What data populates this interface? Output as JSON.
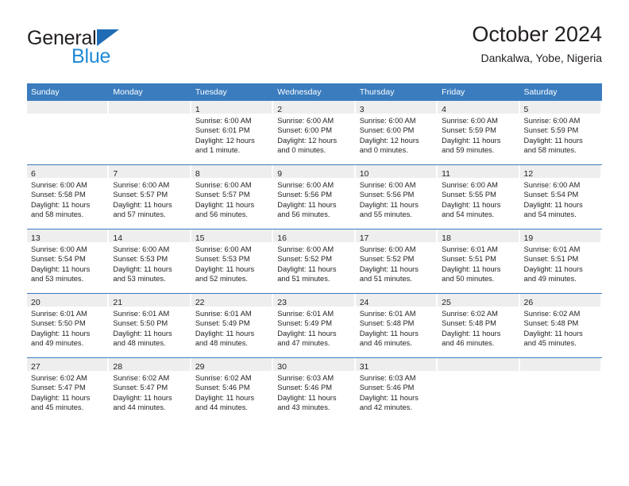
{
  "brand": {
    "logo_primary": "General",
    "logo_secondary": "Blue",
    "triangle_color": "#1f6cb4",
    "secondary_color": "#1f8ad6"
  },
  "header": {
    "title": "October 2024",
    "subtitle": "Dankalwa, Yobe, Nigeria"
  },
  "theme": {
    "header_bg": "#3a7cbe",
    "day_strip_bg": "#eeeeee",
    "text_color": "#231f20",
    "grid_line": "#3a7cbe"
  },
  "weekday_headers": [
    "Sunday",
    "Monday",
    "Tuesday",
    "Wednesday",
    "Thursday",
    "Friday",
    "Saturday"
  ],
  "weeks": [
    [
      {
        "day": "",
        "lines": []
      },
      {
        "day": "",
        "lines": []
      },
      {
        "day": "1",
        "lines": [
          "Sunrise: 6:00 AM",
          "Sunset: 6:01 PM",
          "Daylight: 12 hours",
          "and 1 minute."
        ]
      },
      {
        "day": "2",
        "lines": [
          "Sunrise: 6:00 AM",
          "Sunset: 6:00 PM",
          "Daylight: 12 hours",
          "and 0 minutes."
        ]
      },
      {
        "day": "3",
        "lines": [
          "Sunrise: 6:00 AM",
          "Sunset: 6:00 PM",
          "Daylight: 12 hours",
          "and 0 minutes."
        ]
      },
      {
        "day": "4",
        "lines": [
          "Sunrise: 6:00 AM",
          "Sunset: 5:59 PM",
          "Daylight: 11 hours",
          "and 59 minutes."
        ]
      },
      {
        "day": "5",
        "lines": [
          "Sunrise: 6:00 AM",
          "Sunset: 5:59 PM",
          "Daylight: 11 hours",
          "and 58 minutes."
        ]
      }
    ],
    [
      {
        "day": "6",
        "lines": [
          "Sunrise: 6:00 AM",
          "Sunset: 5:58 PM",
          "Daylight: 11 hours",
          "and 58 minutes."
        ]
      },
      {
        "day": "7",
        "lines": [
          "Sunrise: 6:00 AM",
          "Sunset: 5:57 PM",
          "Daylight: 11 hours",
          "and 57 minutes."
        ]
      },
      {
        "day": "8",
        "lines": [
          "Sunrise: 6:00 AM",
          "Sunset: 5:57 PM",
          "Daylight: 11 hours",
          "and 56 minutes."
        ]
      },
      {
        "day": "9",
        "lines": [
          "Sunrise: 6:00 AM",
          "Sunset: 5:56 PM",
          "Daylight: 11 hours",
          "and 56 minutes."
        ]
      },
      {
        "day": "10",
        "lines": [
          "Sunrise: 6:00 AM",
          "Sunset: 5:56 PM",
          "Daylight: 11 hours",
          "and 55 minutes."
        ]
      },
      {
        "day": "11",
        "lines": [
          "Sunrise: 6:00 AM",
          "Sunset: 5:55 PM",
          "Daylight: 11 hours",
          "and 54 minutes."
        ]
      },
      {
        "day": "12",
        "lines": [
          "Sunrise: 6:00 AM",
          "Sunset: 5:54 PM",
          "Daylight: 11 hours",
          "and 54 minutes."
        ]
      }
    ],
    [
      {
        "day": "13",
        "lines": [
          "Sunrise: 6:00 AM",
          "Sunset: 5:54 PM",
          "Daylight: 11 hours",
          "and 53 minutes."
        ]
      },
      {
        "day": "14",
        "lines": [
          "Sunrise: 6:00 AM",
          "Sunset: 5:53 PM",
          "Daylight: 11 hours",
          "and 53 minutes."
        ]
      },
      {
        "day": "15",
        "lines": [
          "Sunrise: 6:00 AM",
          "Sunset: 5:53 PM",
          "Daylight: 11 hours",
          "and 52 minutes."
        ]
      },
      {
        "day": "16",
        "lines": [
          "Sunrise: 6:00 AM",
          "Sunset: 5:52 PM",
          "Daylight: 11 hours",
          "and 51 minutes."
        ]
      },
      {
        "day": "17",
        "lines": [
          "Sunrise: 6:00 AM",
          "Sunset: 5:52 PM",
          "Daylight: 11 hours",
          "and 51 minutes."
        ]
      },
      {
        "day": "18",
        "lines": [
          "Sunrise: 6:01 AM",
          "Sunset: 5:51 PM",
          "Daylight: 11 hours",
          "and 50 minutes."
        ]
      },
      {
        "day": "19",
        "lines": [
          "Sunrise: 6:01 AM",
          "Sunset: 5:51 PM",
          "Daylight: 11 hours",
          "and 49 minutes."
        ]
      }
    ],
    [
      {
        "day": "20",
        "lines": [
          "Sunrise: 6:01 AM",
          "Sunset: 5:50 PM",
          "Daylight: 11 hours",
          "and 49 minutes."
        ]
      },
      {
        "day": "21",
        "lines": [
          "Sunrise: 6:01 AM",
          "Sunset: 5:50 PM",
          "Daylight: 11 hours",
          "and 48 minutes."
        ]
      },
      {
        "day": "22",
        "lines": [
          "Sunrise: 6:01 AM",
          "Sunset: 5:49 PM",
          "Daylight: 11 hours",
          "and 48 minutes."
        ]
      },
      {
        "day": "23",
        "lines": [
          "Sunrise: 6:01 AM",
          "Sunset: 5:49 PM",
          "Daylight: 11 hours",
          "and 47 minutes."
        ]
      },
      {
        "day": "24",
        "lines": [
          "Sunrise: 6:01 AM",
          "Sunset: 5:48 PM",
          "Daylight: 11 hours",
          "and 46 minutes."
        ]
      },
      {
        "day": "25",
        "lines": [
          "Sunrise: 6:02 AM",
          "Sunset: 5:48 PM",
          "Daylight: 11 hours",
          "and 46 minutes."
        ]
      },
      {
        "day": "26",
        "lines": [
          "Sunrise: 6:02 AM",
          "Sunset: 5:48 PM",
          "Daylight: 11 hours",
          "and 45 minutes."
        ]
      }
    ],
    [
      {
        "day": "27",
        "lines": [
          "Sunrise: 6:02 AM",
          "Sunset: 5:47 PM",
          "Daylight: 11 hours",
          "and 45 minutes."
        ]
      },
      {
        "day": "28",
        "lines": [
          "Sunrise: 6:02 AM",
          "Sunset: 5:47 PM",
          "Daylight: 11 hours",
          "and 44 minutes."
        ]
      },
      {
        "day": "29",
        "lines": [
          "Sunrise: 6:02 AM",
          "Sunset: 5:46 PM",
          "Daylight: 11 hours",
          "and 44 minutes."
        ]
      },
      {
        "day": "30",
        "lines": [
          "Sunrise: 6:03 AM",
          "Sunset: 5:46 PM",
          "Daylight: 11 hours",
          "and 43 minutes."
        ]
      },
      {
        "day": "31",
        "lines": [
          "Sunrise: 6:03 AM",
          "Sunset: 5:46 PM",
          "Daylight: 11 hours",
          "and 42 minutes."
        ]
      },
      {
        "day": "",
        "lines": []
      },
      {
        "day": "",
        "lines": []
      }
    ]
  ]
}
